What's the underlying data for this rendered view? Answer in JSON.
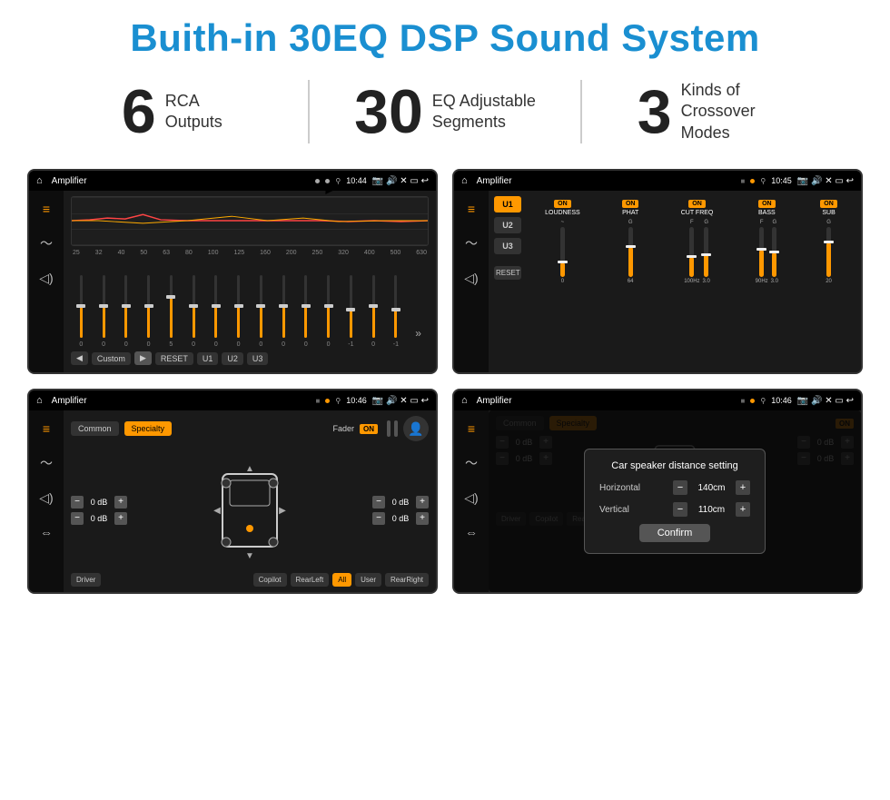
{
  "header": {
    "title": "Buith-in 30EQ DSP Sound System"
  },
  "stats": [
    {
      "number": "6",
      "text_line1": "RCA",
      "text_line2": "Outputs"
    },
    {
      "number": "30",
      "text_line1": "EQ Adjustable",
      "text_line2": "Segments"
    },
    {
      "number": "3",
      "text_line1": "Kinds of",
      "text_line2": "Crossover Modes"
    }
  ],
  "screens": [
    {
      "id": "eq-screen",
      "status_bar": {
        "title": "Amplifier",
        "time": "10:44"
      },
      "type": "eq"
    },
    {
      "id": "dsp-screen",
      "status_bar": {
        "title": "Amplifier",
        "time": "10:45"
      },
      "type": "dsp"
    },
    {
      "id": "fader-screen",
      "status_bar": {
        "title": "Amplifier",
        "time": "10:46"
      },
      "type": "fader"
    },
    {
      "id": "distance-screen",
      "status_bar": {
        "title": "Amplifier",
        "time": "10:46"
      },
      "type": "distance",
      "dialog": {
        "title": "Car speaker distance setting",
        "horizontal_label": "Horizontal",
        "horizontal_value": "140cm",
        "vertical_label": "Vertical",
        "vertical_value": "110cm",
        "confirm_label": "Confirm"
      }
    }
  ],
  "eq": {
    "freq_labels": [
      "25",
      "32",
      "40",
      "50",
      "63",
      "80",
      "100",
      "125",
      "160",
      "200",
      "250",
      "320",
      "400",
      "500",
      "630"
    ],
    "values": [
      "0",
      "0",
      "0",
      "0",
      "5",
      "0",
      "0",
      "0",
      "0",
      "0",
      "0",
      "0",
      "-1",
      "0",
      "-1"
    ],
    "preset": "Custom",
    "buttons": [
      "RESET",
      "U1",
      "U2",
      "U3"
    ]
  },
  "dsp": {
    "presets": [
      "U1",
      "U2",
      "U3"
    ],
    "labels": [
      "LOUDNESS",
      "PHAT",
      "CUT FREQ",
      "BASS",
      "SUB"
    ],
    "reset_label": "RESET"
  },
  "fader": {
    "tab_common": "Common",
    "tab_specialty": "Specialty",
    "fader_label": "Fader",
    "on_label": "ON",
    "db_values": [
      "0 dB",
      "0 dB",
      "0 dB",
      "0 dB"
    ],
    "buttons": {
      "driver": "Driver",
      "copilot": "Copilot",
      "rear_left": "RearLeft",
      "rear_right": "RearRight",
      "all": "All",
      "user": "User"
    }
  },
  "distance_dialog": {
    "title": "Car speaker distance setting",
    "horizontal_label": "Horizontal",
    "horizontal_value": "140cm",
    "vertical_label": "Vertical",
    "vertical_value": "110cm",
    "confirm_label": "Confirm"
  }
}
